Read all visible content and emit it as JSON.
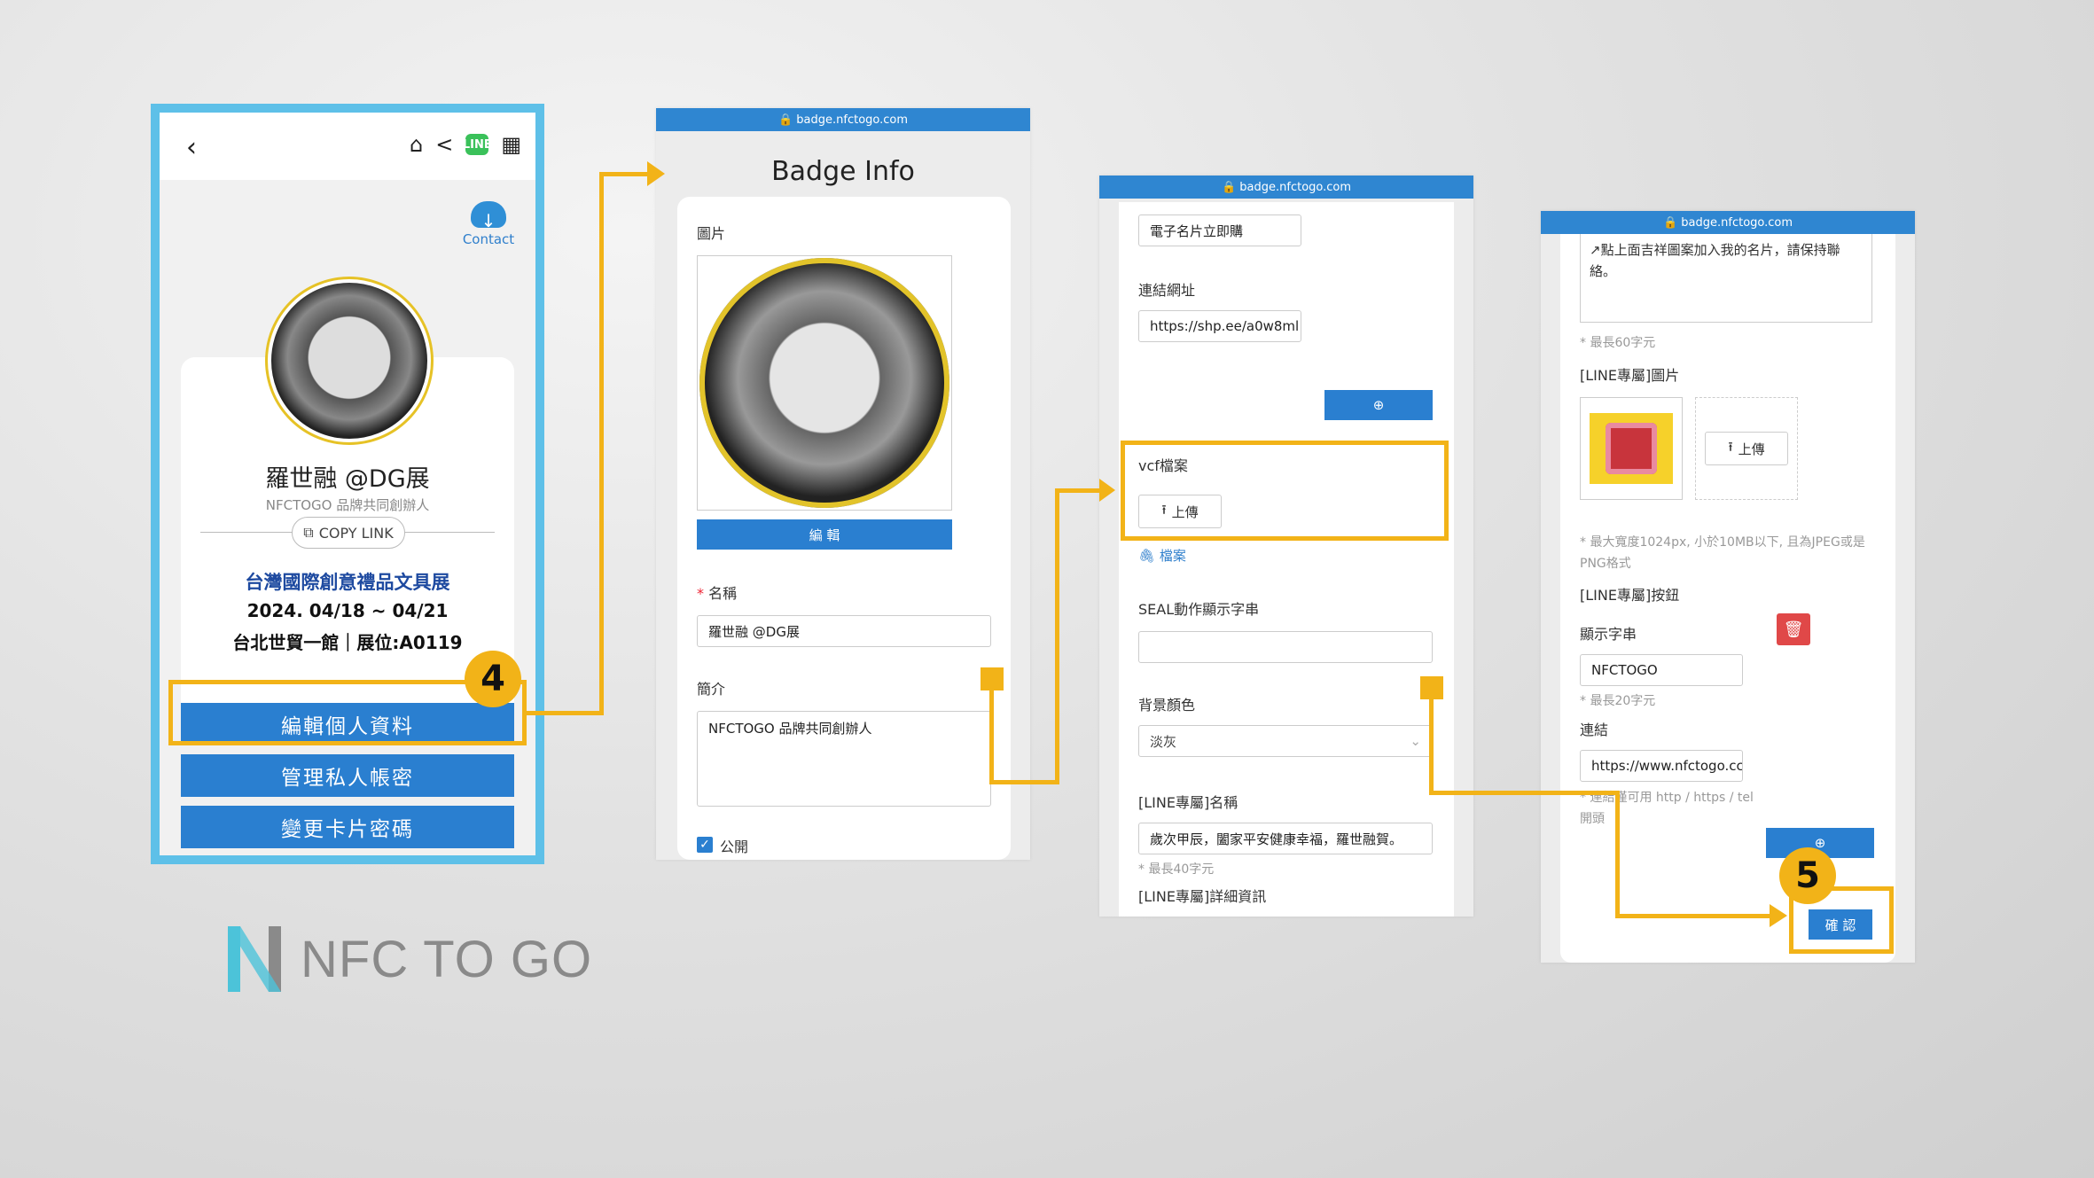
{
  "phone": {
    "back_icon": "‹",
    "home_icon": "⌂",
    "share_icon": "<",
    "line_icon": "LINE",
    "qr_icon": "▦",
    "contact_label": "Contact",
    "name": "羅世融 @DG展",
    "subtitle": "NFCTOGO 品牌共同創辦人",
    "copy_link": "COPY LINK",
    "event_title": "台灣國際創意禮品文具展",
    "event_date": "2024. 04/18 ~ 04/21",
    "event_venue": "台北世貿一館｜展位:A0119",
    "btn_edit": "編輯個人資料",
    "btn_manage": "管理私人帳密",
    "btn_password": "變更卡片密碼"
  },
  "steps": {
    "step4": "4",
    "step5": "5"
  },
  "logo": {
    "text": "NFC TO GO"
  },
  "badge_info": {
    "url": "🔒 badge.nfctogo.com",
    "title": "Badge Info",
    "image_label": "圖片",
    "edit_btn": "編 輯",
    "name_label": "名稱",
    "name_value": "羅世融 @DG展",
    "bio_label": "簡介",
    "bio_value": "NFCTOGO 品牌共同創辦人",
    "public_label": "公開"
  },
  "shot3": {
    "url": "🔒 badge.nfctogo.com",
    "top_input": "電子名片立即購",
    "link_label": "連結網址",
    "link_value": "https://shp.ee/a0w8ml",
    "vcf_label": "vcf檔案",
    "upload_btn": "上傳",
    "file_link": "檔案",
    "seal_label": "SEAL動作顯示字串",
    "bg_label": "背景顏色",
    "bg_value": "淡灰",
    "line_name_label": "[LINE專屬]名稱",
    "line_name_value": "歲次甲辰，闔家平安健康幸福，羅世融賀。",
    "line_name_hint": "* 最長40字元",
    "line_detail_label": "[LINE專屬]詳細資訊"
  },
  "shot4": {
    "url": "🔒 badge.nfctogo.com",
    "detail_text": "點上面吉祥圖案加入我的名片，請保持聯絡。",
    "detail_hint": "* 最長60字元",
    "line_image_label": "[LINE專屬]圖片",
    "upload_btn": "上傳",
    "image_hint": "* 最大寬度1024px, 小於10MB以下, 且為JPEG或是PNG格式",
    "line_button_label": "[LINE專屬]按鈕",
    "display_label": "顯示字串",
    "display_value": "NFCTOGO",
    "display_hint": "* 最長20字元",
    "link_label": "連結",
    "link_value": "https://www.nfctogo.cc",
    "link_hint": "* 連結僅可用 http / https / tel 開頭",
    "confirm_btn": "確 認"
  }
}
